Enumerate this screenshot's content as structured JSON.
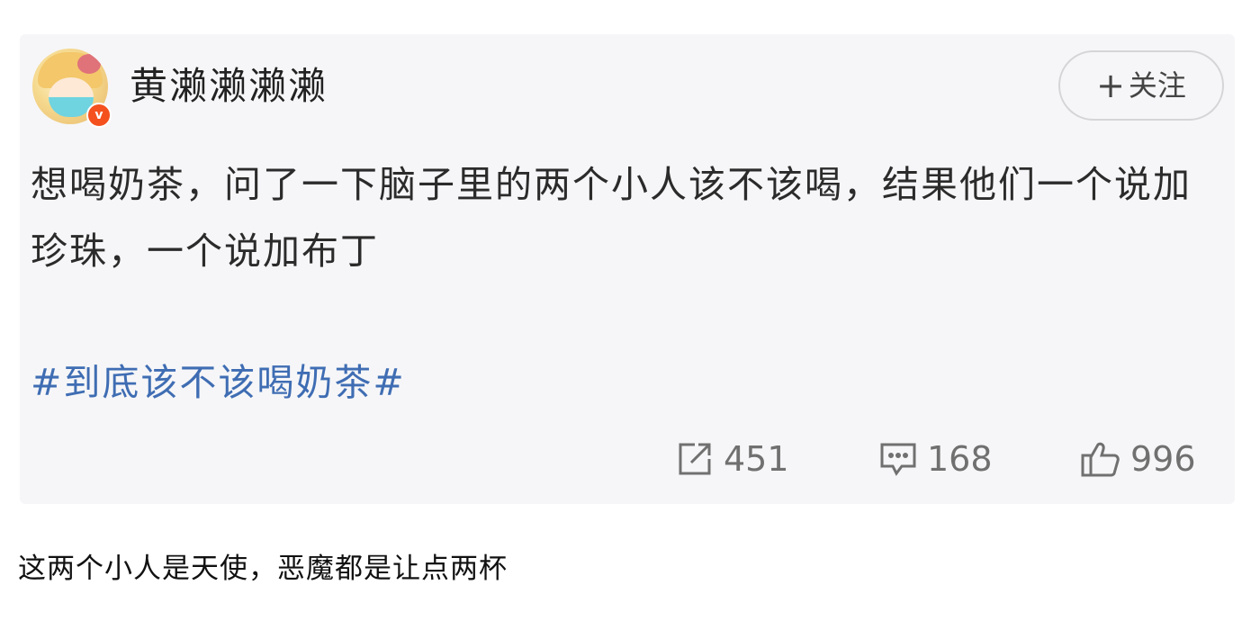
{
  "post": {
    "author": {
      "name": "黄濑濑濑濑",
      "avatar_icon": "anime-girl-avatar",
      "badge_icon": "verified-v-icon",
      "badge_text": "v",
      "badge_color": "#f4511e"
    },
    "follow_button": {
      "icon": "plus-icon",
      "icon_glyph": "+",
      "label": "关注"
    },
    "text": "想喝奶茶，问了一下脑子里的两个小人该不该喝，结果他们一个说加珍珠，一个说加布丁",
    "hashtag": "#到底该不该喝奶茶#",
    "hashtag_color": "#3f6db3",
    "actions": {
      "share": {
        "icon": "share-icon",
        "count": "451"
      },
      "comment": {
        "icon": "comment-icon",
        "count": "168"
      },
      "like": {
        "icon": "thumbs-up-icon",
        "count": "996"
      }
    }
  },
  "caption": "这两个小人是天使，恶魔都是让点两杯"
}
